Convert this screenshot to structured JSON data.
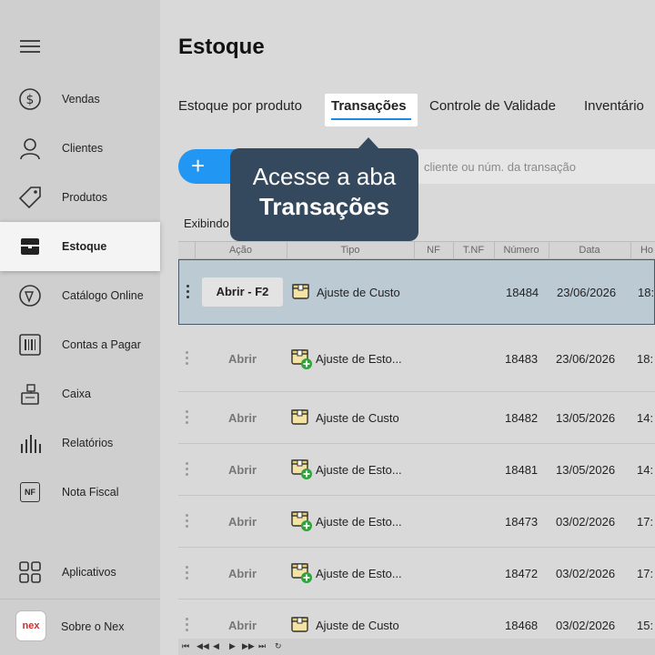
{
  "sidebar": {
    "items": [
      {
        "label": "Vendas",
        "icon": "dollar-circle-icon"
      },
      {
        "label": "Clientes",
        "icon": "person-icon"
      },
      {
        "label": "Produtos",
        "icon": "tag-icon"
      },
      {
        "label": "Estoque",
        "icon": "box-icon",
        "active": true
      },
      {
        "label": "Catálogo Online",
        "icon": "catalog-icon"
      },
      {
        "label": "Contas a Pagar",
        "icon": "barcode-icon"
      },
      {
        "label": "Caixa",
        "icon": "register-icon"
      },
      {
        "label": "Relatórios",
        "icon": "bar-chart-icon"
      },
      {
        "label": "Nota Fiscal",
        "icon": "nf-icon",
        "icon_text": "NF"
      },
      {
        "label": "Aplicativos",
        "icon": "grid-icon"
      }
    ],
    "about": {
      "label": "Sobre o Nex",
      "logo_text": "nex"
    }
  },
  "page": {
    "title": "Estoque"
  },
  "tabs": [
    {
      "label": "Estoque por produto"
    },
    {
      "label": "Transações",
      "active": true
    },
    {
      "label": "Controle de Validade"
    },
    {
      "label": "Inventário"
    }
  ],
  "toolbar": {
    "add_label": "+",
    "search_placeholder": "cliente ou núm. da transação"
  },
  "showing_label": "Exibindo",
  "tooltip": {
    "line1": "Acesse a aba",
    "line2": "Transações"
  },
  "table": {
    "columns": [
      "Ação",
      "Tipo",
      "NF",
      "T.NF",
      "Número",
      "Data",
      "Ho"
    ],
    "rows": [
      {
        "action": "Abrir - F2",
        "tipo": "Ajuste de Custo",
        "kind": "custo",
        "numero": "18484",
        "data": "23/06/2026",
        "hora": "18:",
        "selected": true
      },
      {
        "action": "Abrir",
        "tipo": "Ajuste de Esto...",
        "kind": "estoque",
        "numero": "18483",
        "data": "23/06/2026",
        "hora": "18:"
      },
      {
        "action": "Abrir",
        "tipo": "Ajuste de Custo",
        "kind": "custo",
        "numero": "18482",
        "data": "13/05/2026",
        "hora": "14:"
      },
      {
        "action": "Abrir",
        "tipo": "Ajuste de Esto...",
        "kind": "estoque",
        "numero": "18481",
        "data": "13/05/2026",
        "hora": "14:"
      },
      {
        "action": "Abrir",
        "tipo": "Ajuste de Esto...",
        "kind": "estoque",
        "numero": "18473",
        "data": "03/02/2026",
        "hora": "17:"
      },
      {
        "action": "Abrir",
        "tipo": "Ajuste de Esto...",
        "kind": "estoque",
        "numero": "18472",
        "data": "03/02/2026",
        "hora": "17:"
      },
      {
        "action": "Abrir",
        "tipo": "Ajuste de Custo",
        "kind": "custo",
        "numero": "18468",
        "data": "03/02/2026",
        "hora": "15:"
      }
    ]
  },
  "pager": {
    "buttons": [
      "⏮",
      "◀◀",
      "◀",
      "▶",
      "▶▶",
      "⏭",
      "↻"
    ]
  }
}
